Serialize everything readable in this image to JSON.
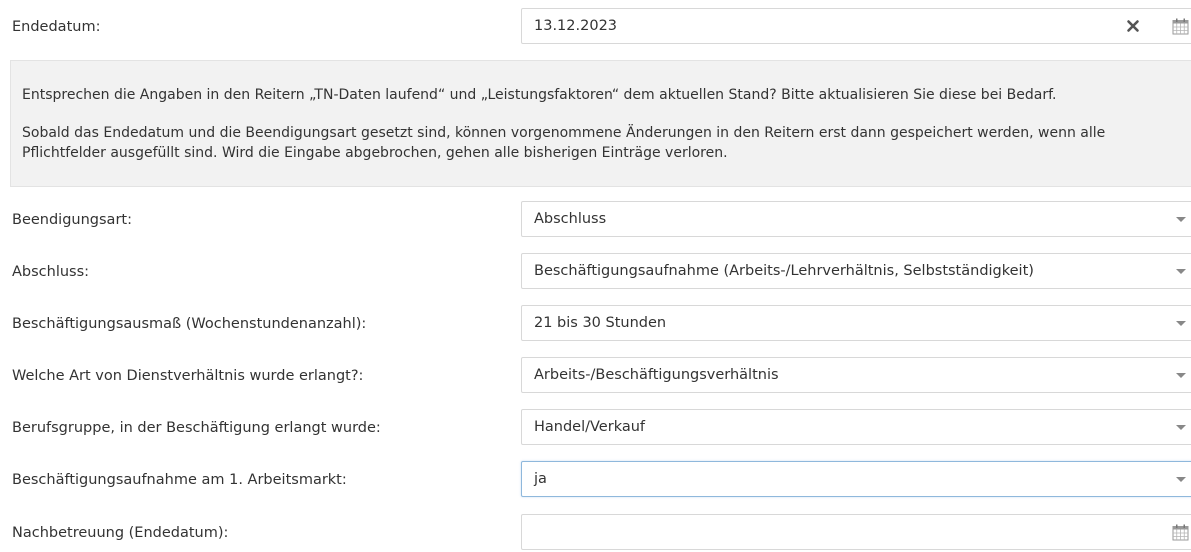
{
  "end_date": {
    "label": "Endedatum:",
    "value": "13.12.2023"
  },
  "info_box": {
    "paragraph1": "Entsprechen die Angaben in den Reitern „TN-Daten laufend“ und „Leistungsfaktoren“ dem aktuellen Stand? Bitte aktualisieren Sie diese bei Bedarf.",
    "paragraph2_line1": "Sobald das Endedatum und die Beendigungsart gesetzt sind, können vorgenommene Änderungen in den Reitern erst dann gespeichert werden, wenn alle",
    "paragraph2_line2": "Pflichtfelder ausgefüllt sind. Wird die Eingabe abgebrochen, gehen alle bisherigen Einträge verloren."
  },
  "fields": [
    {
      "label": "Beendigungsart:",
      "value": "Abschluss"
    },
    {
      "label": "Abschluss:",
      "value": "Beschäftigungsaufnahme (Arbeits-/Lehrverhältnis, Selbstständigkeit)"
    },
    {
      "label": "Beschäftigungsausmaß (Wochenstundenanzahl):",
      "value": "21 bis 30 Stunden"
    },
    {
      "label": "Welche Art von Dienstverhältnis wurde erlangt?:",
      "value": "Arbeits-/Beschäftigungsverhältnis"
    },
    {
      "label": "Berufsgruppe, in der Beschäftigung erlangt wurde:",
      "value": "Handel/Verkauf"
    },
    {
      "label": "Beschäftigungsaufnahme am 1. Arbeitsmarkt:",
      "value": "ja"
    }
  ],
  "follow_up": {
    "label": "Nachbetreuung (Endedatum):",
    "value": ""
  },
  "icons": {
    "clear": "close-icon",
    "date_picker": "calendar-icon",
    "dropdown": "chevron-down-icon"
  }
}
